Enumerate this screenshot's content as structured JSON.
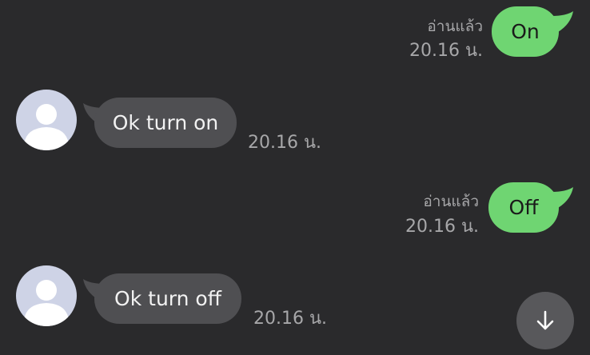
{
  "messages": [
    {
      "direction": "sent",
      "text": "On",
      "read_label": "อ่านแล้ว",
      "time": "20.16 น."
    },
    {
      "direction": "received",
      "text": "Ok turn on",
      "time": "20.16 น."
    },
    {
      "direction": "sent",
      "text": "Off",
      "read_label": "อ่านแล้ว",
      "time": "20.16 น."
    },
    {
      "direction": "received",
      "text": "Ok turn off",
      "time": "20.16 น."
    }
  ],
  "scroll_button": {
    "icon": "arrow-down-icon"
  },
  "colors": {
    "background": "#2a2a2c",
    "sent_bubble": "#6fd572",
    "received_bubble": "#4f4f52",
    "meta_text": "#a7a7a9"
  }
}
